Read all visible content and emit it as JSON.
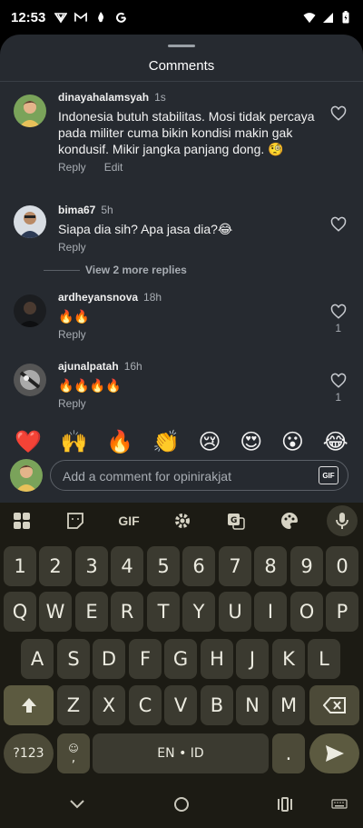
{
  "status": {
    "time": "12:53",
    "left_icons": [
      "vpn-like-icon",
      "gmail-icon",
      "flame-icon",
      "google-icon"
    ],
    "right_icons": [
      "wifi-icon",
      "signal-icon",
      "battery-icon"
    ]
  },
  "sheet": {
    "title": "Comments"
  },
  "comments": [
    {
      "username": "dinayahalamsyah",
      "time": "1s",
      "text": "Indonesia butuh stabilitas. Mosi tidak percaya pada militer cuma bikin kondisi makin gak kondusif. Mikir jangka panjang dong. 🧐",
      "actions": [
        "Reply",
        "Edit"
      ],
      "likes": ""
    },
    {
      "username": "bima67",
      "time": "5h",
      "text": "Siapa dia sih? Apa jasa dia?😂",
      "actions": [
        "Reply"
      ],
      "likes": ""
    },
    {
      "username": "ardheyansnova",
      "time": "18h",
      "text": "🔥🔥",
      "actions": [
        "Reply"
      ],
      "likes": "1"
    },
    {
      "username": "ajunalpatah",
      "time": "16h",
      "text": "🔥🔥🔥🔥",
      "actions": [
        "Reply"
      ],
      "likes": "1"
    }
  ],
  "more_replies": "View 2 more replies",
  "quick_emojis": [
    "❤️",
    "🙌",
    "🔥",
    "👏",
    "😢",
    "😍",
    "😮",
    "😂"
  ],
  "input": {
    "placeholder": "Add a comment for opinirakjat",
    "gif_label": "GIF"
  },
  "keyboard": {
    "toolbar": [
      "apps-icon",
      "sticker-icon",
      "GIF",
      "settings-icon",
      "translate-icon",
      "palette-icon",
      "mic-icon"
    ],
    "toolbar_gif": "GIF",
    "row_numbers": [
      "1",
      "2",
      "3",
      "4",
      "5",
      "6",
      "7",
      "8",
      "9",
      "0"
    ],
    "row1": [
      "Q",
      "W",
      "E",
      "R",
      "T",
      "Y",
      "U",
      "I",
      "O",
      "P"
    ],
    "row2": [
      "A",
      "S",
      "D",
      "F",
      "G",
      "H",
      "J",
      "K",
      "L"
    ],
    "row3": [
      "Z",
      "X",
      "C",
      "V",
      "B",
      "N",
      "M"
    ],
    "symbols_label": "?123",
    "emoji_comma_label": ",",
    "space_label": "EN • ID",
    "period_label": "."
  }
}
